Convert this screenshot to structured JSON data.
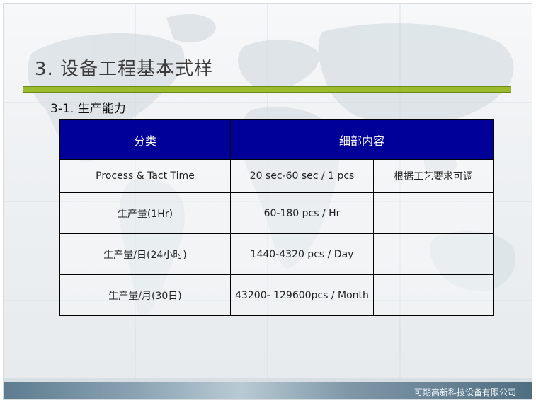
{
  "slide": {
    "title": "3.  设备工程基本式样",
    "subtitle": "3-1. 生产能力",
    "footer": "可期高新科技设备有限公司"
  },
  "table": {
    "headers": [
      "分类",
      "细部内容"
    ],
    "rows": [
      {
        "category": "Process & Tact Time",
        "detail": "20 sec-60 sec  / 1 pcs",
        "note": "根据工艺要求可调"
      },
      {
        "category": "生产量(1Hr)",
        "detail": "60-180 pcs / Hr",
        "note": ""
      },
      {
        "category": "生产量/日(24小时)",
        "detail": "1440-4320 pcs / Day",
        "note": ""
      },
      {
        "category": "生产量/月(30日)",
        "detail": "43200- 129600pcs / Month",
        "note": ""
      }
    ]
  },
  "colors": {
    "header_bg": "#000099",
    "accent_bar": "#9bbb2c"
  }
}
